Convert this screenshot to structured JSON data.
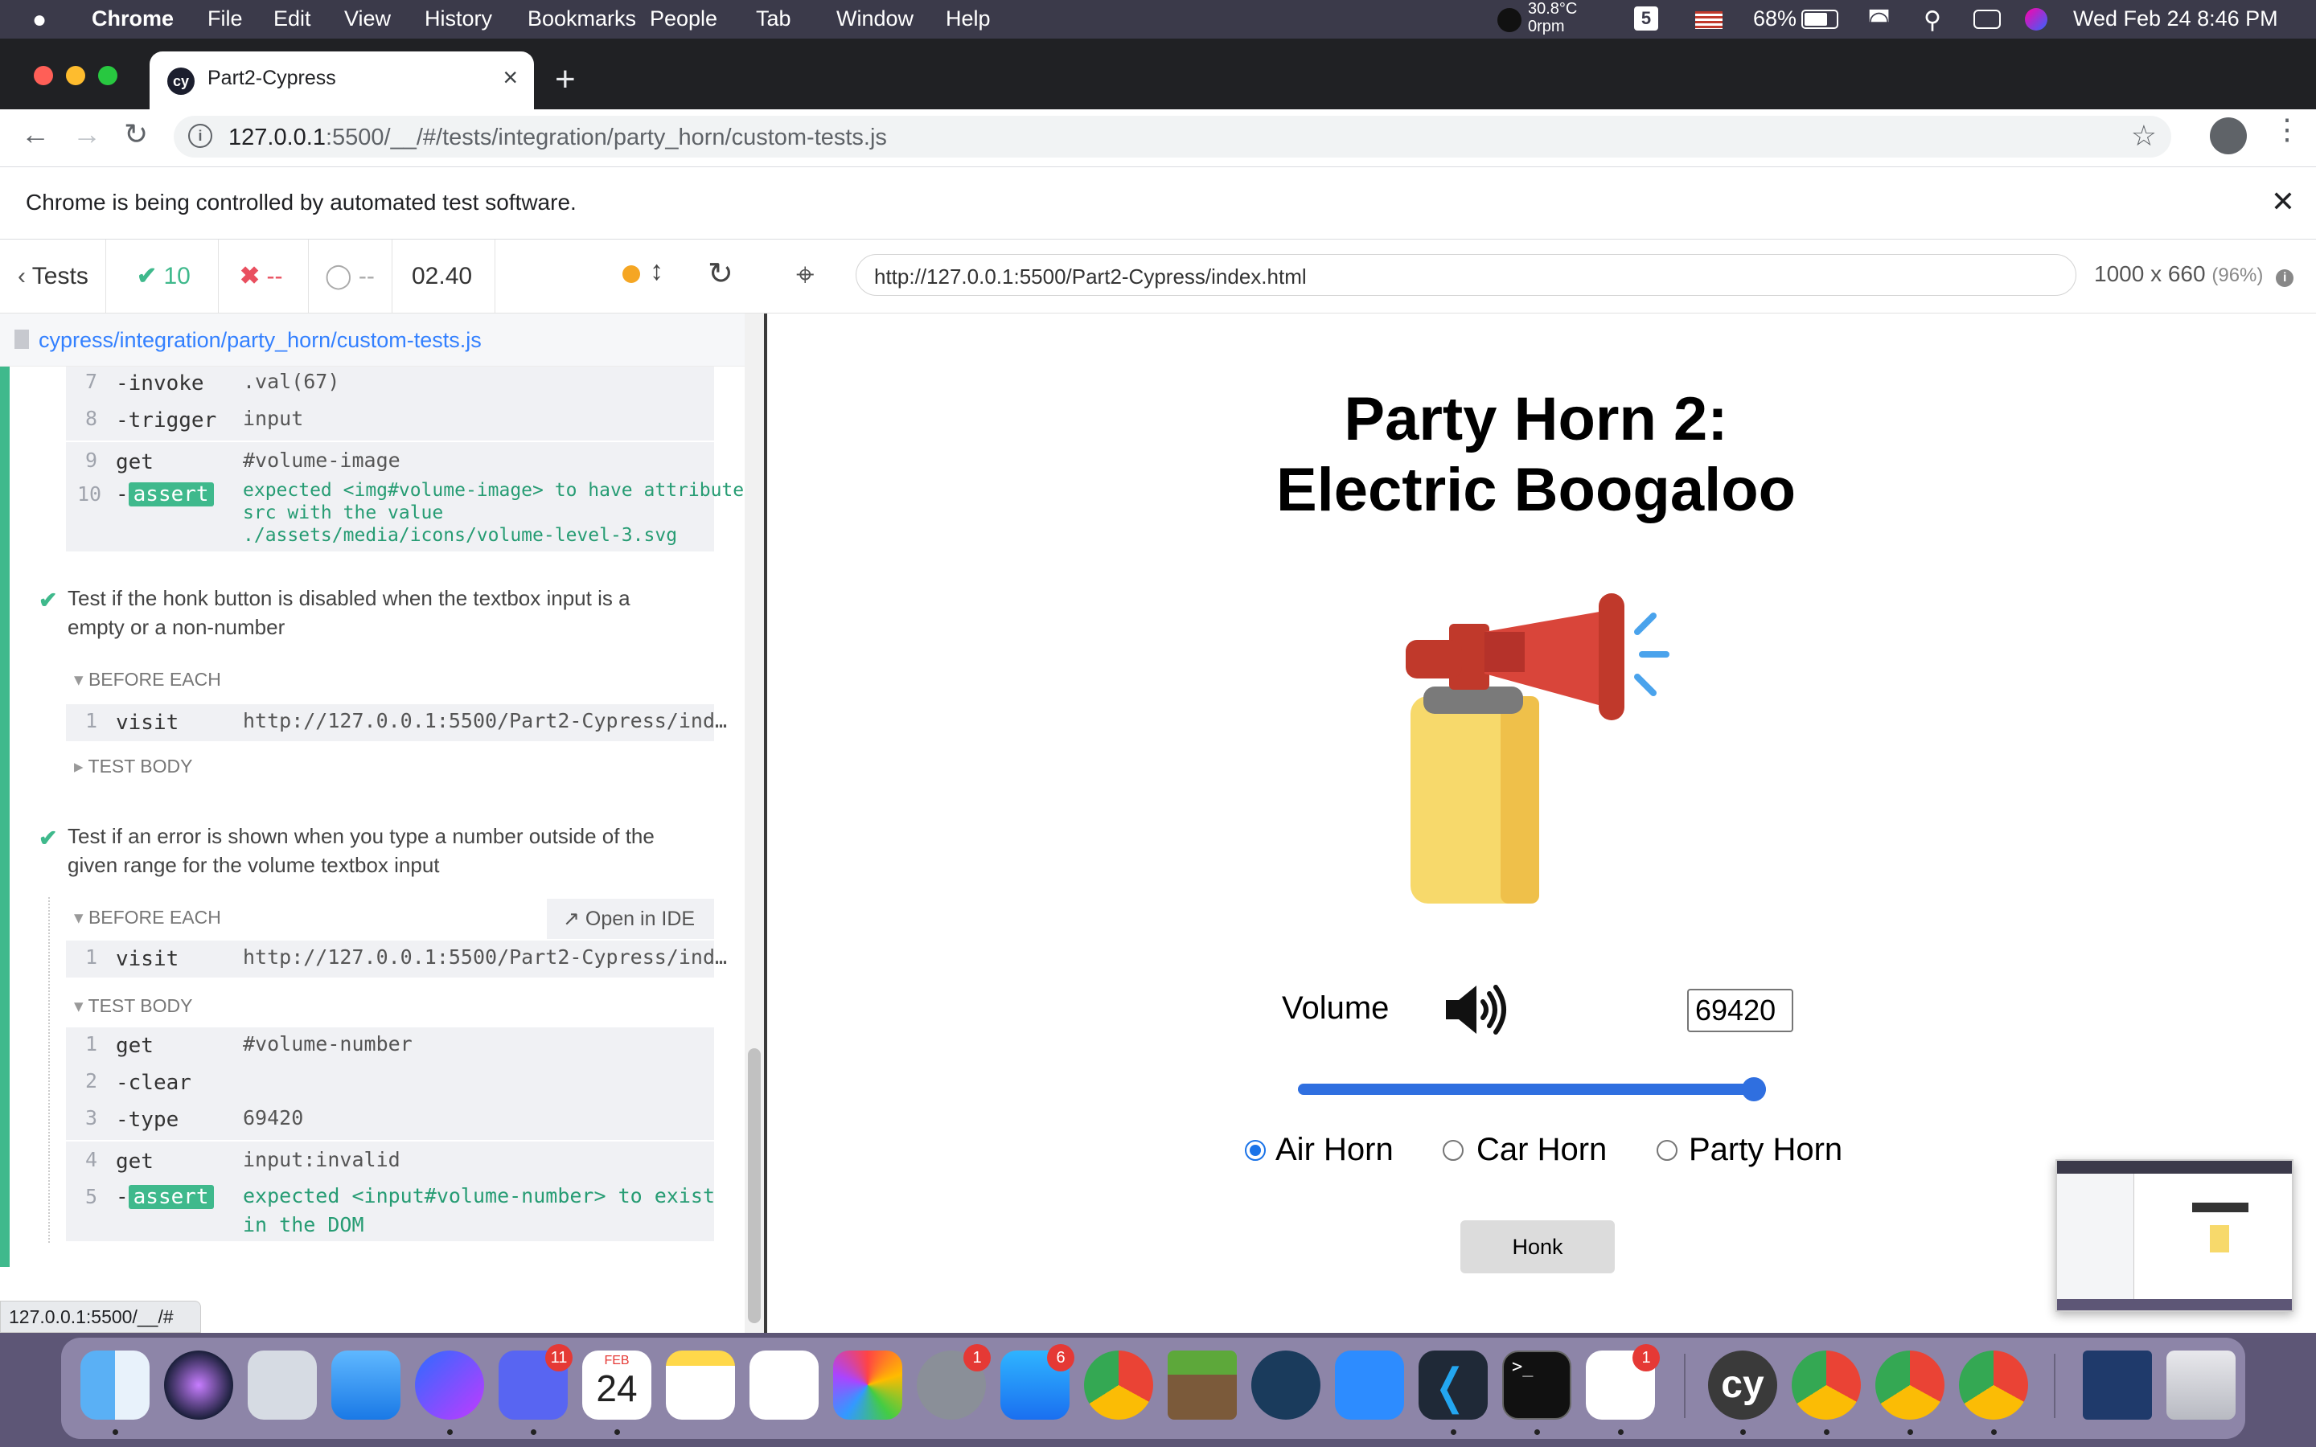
{
  "menubar": {
    "apple": "",
    "app": "Chrome",
    "items": [
      "File",
      "Edit",
      "View",
      "History",
      "Bookmarks",
      "People",
      "Tab",
      "Window",
      "Help"
    ],
    "temp": "30.8°C",
    "rpm": "0rpm",
    "battery": "68%",
    "datetime": "Wed Feb 24  8:46 PM"
  },
  "browser": {
    "tab_title": "Part2-Cypress",
    "tab_favicon": "cy",
    "url_host": "127.0.0.1",
    "url_rest": ":5500/__/#/tests/integration/party_horn/custom-tests.js",
    "banner": "Chrome is being controlled by automated test software.",
    "status_url": "127.0.0.1:5500/__/#"
  },
  "reporter": {
    "back_label": "Tests",
    "passed": "10",
    "failed": "--",
    "pending": "--",
    "duration": "02.40",
    "spec_file": "cypress/integration/party_horn/custom-tests.js",
    "block1": [
      {
        "num": "7",
        "name": "-invoke",
        "msg": ".val(67)"
      },
      {
        "num": "8",
        "name": "-trigger",
        "msg": "input"
      },
      {
        "num": "9",
        "name": "get",
        "msg": "#volume-image"
      },
      {
        "num": "10",
        "name": "-assert",
        "assert": "assert",
        "msg_l1": "expected <img#volume-image> to have attribute",
        "msg_l2": "src with the value",
        "msg_l3": "./assets/media/icons/volume-level-3.svg"
      }
    ],
    "test2_title": "Test if the honk button is disabled when the textbox input is a empty or a non-number",
    "before_each": "BEFORE EACH",
    "test_body": "TEST BODY",
    "visit": {
      "num": "1",
      "name": "visit",
      "msg": "http://127.0.0.1:5500/Part2-Cypress/ind…"
    },
    "test3_title": "Test if an error is shown when you type a number outside of the given range for the volume textbox input",
    "open_ide": "Open in IDE",
    "block3": [
      {
        "num": "1",
        "name": "get",
        "msg": "#volume-number"
      },
      {
        "num": "2",
        "name": "-clear",
        "msg": ""
      },
      {
        "num": "3",
        "name": "-type",
        "msg": "69420"
      },
      {
        "num": "4",
        "name": "get",
        "msg": "input:invalid"
      },
      {
        "num": "5",
        "name": "-assert",
        "assert": "assert",
        "msg_l1": "expected <input#volume-number> to exist",
        "msg_l2": "in the DOM"
      }
    ]
  },
  "aut": {
    "url": "http://127.0.0.1:5500/Part2-Cypress/index.html",
    "size": "1000 x 660",
    "scale": "(96%)"
  },
  "app": {
    "title_line1": "Party Horn 2:",
    "title_line2": "Electric Boogaloo",
    "volume_label": "Volume",
    "volume_value": "69420",
    "slider_fraction": 1.0,
    "radios": [
      {
        "label": "Air Horn",
        "checked": true
      },
      {
        "label": "Car Horn",
        "checked": false
      },
      {
        "label": "Party Horn",
        "checked": false
      }
    ],
    "honk_label": "Honk"
  },
  "dock": {
    "discord_badge": "11",
    "calendar_month": "FEB",
    "calendar_day": "24",
    "settings_badge": "1",
    "appstore_badge": "6",
    "slack_badge": "1",
    "cypress_label": "cy"
  },
  "colors": {
    "pass": "#3fb98c",
    "fail": "#e94f5f",
    "link": "#3380ff",
    "slider": "#2f6fe0"
  }
}
